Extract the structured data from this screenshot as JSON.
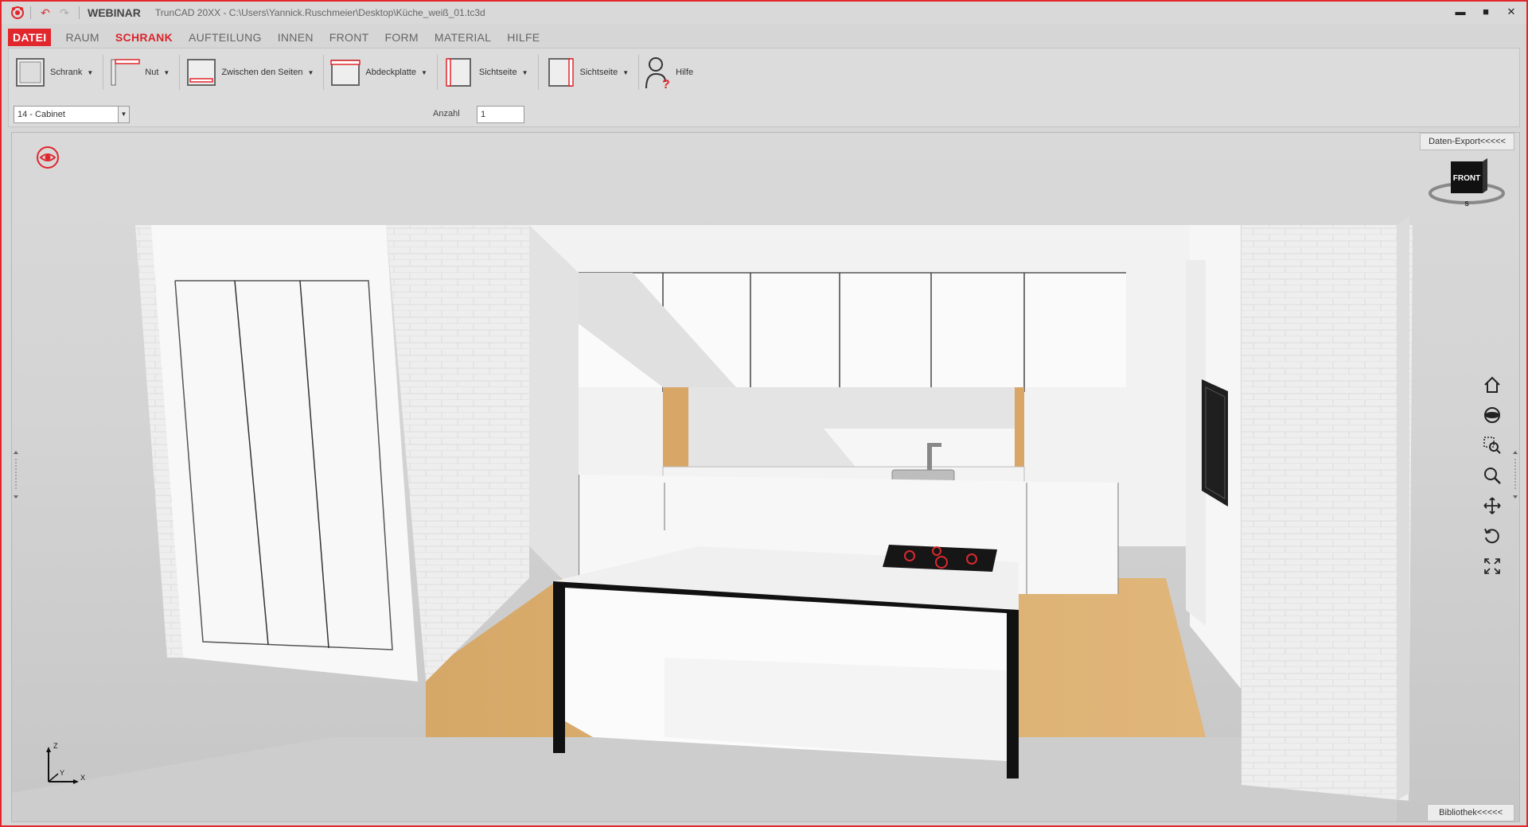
{
  "titlebar": {
    "app_name": "WEBINAR",
    "file_path": "TrunCAD 20XX - C:\\Users\\Yannick.Ruschmeier\\Desktop\\Küche_weiß_01.tc3d",
    "minimize": "▬",
    "maximize": "■",
    "close": "✕",
    "undo_icon": "undo-icon",
    "redo_icon": "redo-icon"
  },
  "menu": {
    "items": [
      "DATEI",
      "RAUM",
      "SCHRANK",
      "AUFTEILUNG",
      "INNEN",
      "FRONT",
      "FORM",
      "MATERIAL",
      "HILFE"
    ],
    "active": "SCHRANK"
  },
  "ribbon": {
    "buttons": [
      {
        "label": "Schrank",
        "icon": "cabinet-icon"
      },
      {
        "label": "Nut",
        "icon": "groove-icon"
      },
      {
        "label": "Zwischen den Seiten",
        "icon": "between-sides-icon"
      },
      {
        "label": "Abdeckplatte",
        "icon": "cover-plate-icon"
      },
      {
        "label": "Sichtseite",
        "icon": "visible-side-left-icon"
      },
      {
        "label": "Sichtseite",
        "icon": "visible-side-right-icon"
      },
      {
        "label": "Hilfe",
        "icon": "help-person-icon"
      }
    ],
    "cabinet_select": "14 - Cabinet",
    "anzahl_label": "Anzahl",
    "anzahl_value": "1"
  },
  "viewport": {
    "export_label": "Daten-Export<<<<<",
    "library_label": "Bibliothek<<<<<",
    "navcube_face": "FRONT",
    "navcube_compass": "S",
    "axis_labels": {
      "x": "X",
      "y": "Y",
      "z": "Z"
    },
    "nav_tools": [
      "home-icon",
      "orbit-icon",
      "zoom-window-icon",
      "zoom-icon",
      "pan-icon",
      "rotate-icon",
      "fit-all-icon"
    ]
  },
  "colors": {
    "accent": "#e1262c",
    "wood": "#d9a86a",
    "wall": "#ededed",
    "cabinet": "#f7f7f7"
  }
}
